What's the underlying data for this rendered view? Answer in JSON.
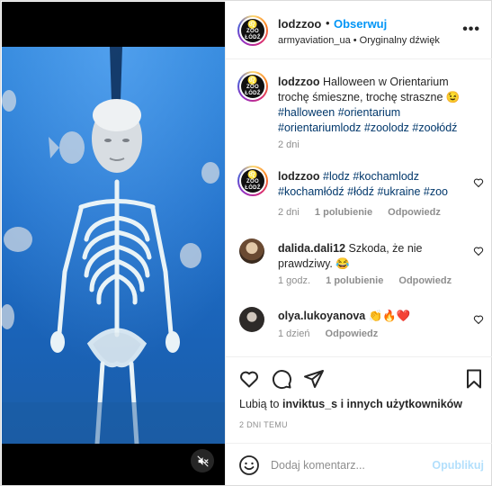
{
  "post": {
    "username": "lodzzoo",
    "separator": "•",
    "follow_label": "Obserwuj",
    "audio_source": "armyaviation_ua • Oryginalny dźwięk",
    "more_label": "•••",
    "avatar_text": [
      "ZOO",
      "ŁÓDŹ"
    ]
  },
  "caption": {
    "username": "lodzzoo",
    "text": "Halloween w Orientarium trochę śmieszne, trochę straszne 😉",
    "tags": "#halloween #orientarium #orientariumlodz #zoolodz #zoołódź",
    "time": "2 dni"
  },
  "comments": [
    {
      "username": "lodzzoo",
      "text": "#lodz #kochamlodz #kochamłódź #łódź #ukraine #zoo",
      "time": "2 dni",
      "likes": "1 polubienie",
      "reply": "Odpowiedz"
    },
    {
      "username": "dalida.dali12",
      "text": "Szkoda, że nie prawdziwy. 😂",
      "time": "1 godz.",
      "likes": "1 polubienie",
      "reply": "Odpowiedz"
    },
    {
      "username": "olya.lukoyanova",
      "text": "👏🔥❤️",
      "time": "1 dzień",
      "reply": "Odpowiedz"
    }
  ],
  "likes_line": {
    "prefix": "Lubią to",
    "user": "inviktus_s",
    "suffix": "i innych użytkowników"
  },
  "timestamp": "2 DNI TEMU",
  "composer": {
    "placeholder": "Dodaj komentarz...",
    "publish_label": "Opublikuj"
  },
  "colors": {
    "accent": "#0095f6",
    "hashtag": "#00376b",
    "muted": "#8e8e8e",
    "publish_disabled": "#b2dffc"
  },
  "icons": [
    "mute-icon",
    "heart-icon",
    "comment-icon",
    "share-icon",
    "bookmark-icon",
    "emoji-icon",
    "more-icon"
  ]
}
